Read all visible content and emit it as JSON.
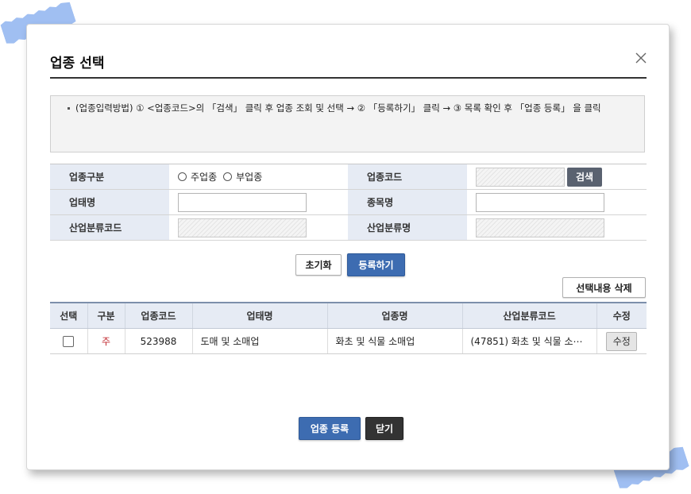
{
  "dialog": {
    "title": "업종 선택",
    "close_icon": "close-icon"
  },
  "notice": {
    "text": "(업종입력방법) ① <업종코드>의 「검색」 클릭 후 업종 조회 및 선택 → ② 「등록하기」 클릭 → ③ 목록 확인 후 「업종 등록」 을 클릭"
  },
  "form": {
    "business_type_label": "업종구분",
    "radio_main": "주업종",
    "radio_sub": "부업종",
    "business_code_label": "업종코드",
    "search_button": "검색",
    "business_form_label": "업태명",
    "item_label": "종목명",
    "industry_code_label": "산업분류코드",
    "industry_name_label": "산업분류명"
  },
  "actions": {
    "reset": "초기화",
    "register": "등록하기",
    "delete_selected": "선택내용 삭제"
  },
  "table": {
    "headers": [
      "선택",
      "구분",
      "업종코드",
      "업태명",
      "업종명",
      "산업분류코드",
      "수정"
    ],
    "rows": [
      {
        "type": "주",
        "code": "523988",
        "business_form": "도매 및 소매업",
        "business_name": "화초 및 식물 소매업",
        "industry_code": "(47851) 화초 및 식물 소⋯",
        "edit": "수정"
      }
    ]
  },
  "footer": {
    "submit": "업종 등록",
    "close": "닫기"
  },
  "colors": {
    "primary_blue": "#3d6cb1",
    "label_bg": "#e6ebf4",
    "accent_red": "#c0272d",
    "tape": "#8fb4f0"
  }
}
